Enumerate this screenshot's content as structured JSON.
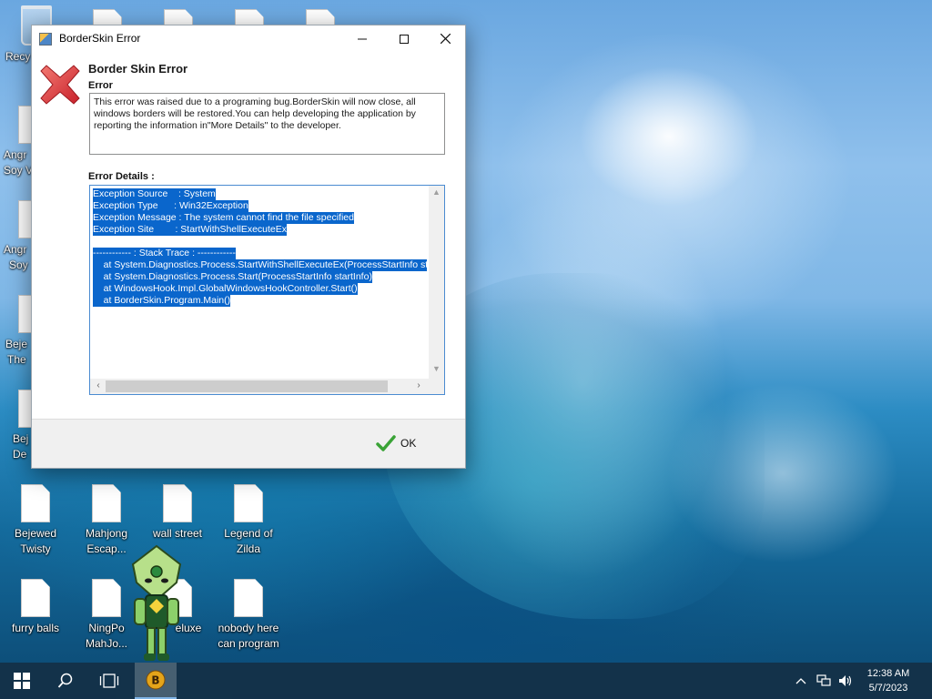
{
  "dialog": {
    "title": "BorderSkin Error",
    "heading": "Border Skin Error",
    "error_label": "Error",
    "message": "This error was raised due to a programing bug.BorderSkin will now close, all windows borders will be restored.You can help developing the application by reporting the information in\"More Details\" to the developer.",
    "details_label": "Error Details :",
    "details_lines": [
      "Exception Source    : System",
      "Exception Type      : Win32Exception",
      "Exception Message : The system cannot find the file specified",
      "Exception Site        : StartWithShellExecuteEx",
      "",
      "------------ : Stack Trace : ------------",
      "    at System.Diagnostics.Process.StartWithShellExecuteEx(ProcessStartInfo st",
      "    at System.Diagnostics.Process.Start(ProcessStartInfo startInfo)",
      "    at WindowsHook.Impl.GlobalWindowsHookController.Start()",
      "    at BorderSkin.Program.Main()"
    ],
    "ok_label": "OK"
  },
  "desktop": {
    "icons": [
      {
        "label_1": "Recy",
        "label_2": ""
      },
      {
        "label_1": "Angr",
        "label_2": "Soy V"
      },
      {
        "label_1": "Angr",
        "label_2": "Soy"
      },
      {
        "label_1": "Beje",
        "label_2": "The"
      },
      {
        "label_1": "Bej",
        "label_2": "De"
      },
      {
        "label_1": "Bejewed",
        "label_2": "Twisty"
      },
      {
        "label_1": "Mahjong",
        "label_2": "Escap..."
      },
      {
        "label_1": "wall street",
        "label_2": ""
      },
      {
        "label_1": "Legend of",
        "label_2": "Zilda"
      },
      {
        "label_1": "furry balls",
        "label_2": ""
      },
      {
        "label_1": "NingPo",
        "label_2": "MahJo..."
      },
      {
        "label_1": "eluxe",
        "label_2": ""
      },
      {
        "label_1": "nobody here",
        "label_2": "can program"
      }
    ]
  },
  "taskbar": {
    "time": "12:38 AM",
    "date": "5/7/2023"
  },
  "colors": {
    "selection": "#0a66cc",
    "error_red": "#e0393c",
    "ok_green": "#3aa336"
  }
}
